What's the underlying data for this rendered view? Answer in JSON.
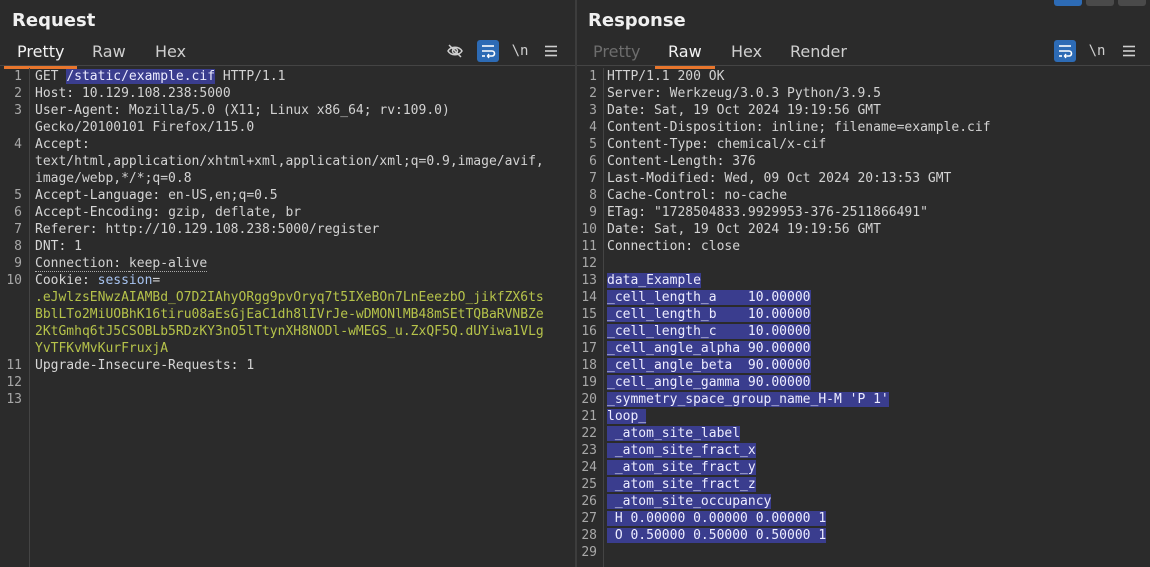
{
  "request": {
    "title": "Request",
    "tabs": [
      "Pretty",
      "Raw",
      "Hex"
    ],
    "lines": [
      {
        "n": "1",
        "parts": [
          [
            "GET ",
            "hv"
          ],
          [
            "/static/example.cif",
            "sel"
          ],
          [
            " HTTP/1.1",
            "hv"
          ]
        ]
      },
      {
        "n": "2",
        "parts": [
          [
            "Host: ",
            "hk"
          ],
          [
            "10.129.108.238:5000",
            "hv"
          ]
        ]
      },
      {
        "n": "3",
        "parts": [
          [
            "User-Agent: ",
            "hk"
          ],
          [
            "Mozilla/5.0 (X11; Linux x86_64; rv:109.0)",
            "hv"
          ]
        ]
      },
      {
        "n": "",
        "parts": [
          [
            "Gecko/20100101 Firefox/115.0",
            "hv"
          ]
        ]
      },
      {
        "n": "4",
        "parts": [
          [
            "Accept:",
            "hk"
          ]
        ]
      },
      {
        "n": "",
        "parts": [
          [
            "text/html,application/xhtml+xml,application/xml;q=0.9,image/avif,",
            "hv"
          ]
        ]
      },
      {
        "n": "",
        "parts": [
          [
            "image/webp,*/*;q=0.8",
            "hv"
          ]
        ]
      },
      {
        "n": "5",
        "parts": [
          [
            "Accept-Language: ",
            "hk"
          ],
          [
            "en-US,en;q=0.5",
            "hv"
          ]
        ]
      },
      {
        "n": "6",
        "parts": [
          [
            "Accept-Encoding: ",
            "hk"
          ],
          [
            "gzip, deflate, br",
            "hv"
          ]
        ]
      },
      {
        "n": "7",
        "parts": [
          [
            "Referer: ",
            "hk"
          ],
          [
            "http://10.129.108.238:5000/register",
            "hv"
          ]
        ]
      },
      {
        "n": "8",
        "parts": [
          [
            "DNT: ",
            "hk"
          ],
          [
            "1",
            "hv"
          ]
        ]
      },
      {
        "n": "9",
        "parts": [
          [
            "Connection: ",
            "dotted"
          ],
          [
            "keep-alive",
            "dotted"
          ]
        ]
      },
      {
        "n": "10",
        "parts": [
          [
            "Cookie: ",
            "hk"
          ],
          [
            "session",
            "ck"
          ],
          [
            "=",
            "hv"
          ]
        ]
      },
      {
        "n": "",
        "parts": [
          [
            ".eJwlzsENwzAIAMBd_O7D2IAhyORgg9pvOryq7t5IXeBOn7LnEeezbO_jikfZX6ts",
            "cv"
          ]
        ]
      },
      {
        "n": "",
        "parts": [
          [
            "BblLTo2MiUOBhK16tiru08aEsGjEaC1dh8lIVrJe-wDMONlMB48mSEtTQBaRVNBZe",
            "cv"
          ]
        ]
      },
      {
        "n": "",
        "parts": [
          [
            "2KtGmhq6tJ5CSOBLb5RDzKY3nO5lTtynXH8NODl-wMEGS_u.ZxQF5Q.dUYiwa1VLg",
            "cv"
          ]
        ]
      },
      {
        "n": "",
        "parts": [
          [
            "YvTFKvMvKurFruxjA",
            "cv"
          ]
        ]
      },
      {
        "n": "11",
        "parts": [
          [
            "Upgrade-Insecure-Requests: ",
            "hk"
          ],
          [
            "1",
            "hv"
          ]
        ]
      },
      {
        "n": "12",
        "parts": []
      },
      {
        "n": "13",
        "parts": []
      }
    ]
  },
  "response": {
    "title": "Response",
    "tabs": [
      "Pretty",
      "Raw",
      "Hex",
      "Render"
    ],
    "lines": [
      {
        "n": "1",
        "parts": [
          [
            "HTTP/1.1 200 OK",
            "hv"
          ]
        ]
      },
      {
        "n": "2",
        "parts": [
          [
            "Server: ",
            "hk"
          ],
          [
            "Werkzeug/3.0.3 Python/3.9.5",
            "hv"
          ]
        ]
      },
      {
        "n": "3",
        "parts": [
          [
            "Date: ",
            "hk"
          ],
          [
            "Sat, 19 Oct 2024 19:19:56 GMT",
            "hv"
          ]
        ]
      },
      {
        "n": "4",
        "parts": [
          [
            "Content-Disposition: ",
            "hk"
          ],
          [
            "inline; filename=example.cif",
            "hv"
          ]
        ]
      },
      {
        "n": "5",
        "parts": [
          [
            "Content-Type: ",
            "hk"
          ],
          [
            "chemical/x-cif",
            "hv"
          ]
        ]
      },
      {
        "n": "6",
        "parts": [
          [
            "Content-Length: ",
            "hk"
          ],
          [
            "376",
            "hv"
          ]
        ]
      },
      {
        "n": "7",
        "parts": [
          [
            "Last-Modified: ",
            "hk"
          ],
          [
            "Wed, 09 Oct 2024 20:13:53 GMT",
            "hv"
          ]
        ]
      },
      {
        "n": "8",
        "parts": [
          [
            "Cache-Control: ",
            "hk"
          ],
          [
            "no-cache",
            "hv"
          ]
        ]
      },
      {
        "n": "9",
        "parts": [
          [
            "ETag: ",
            "hk"
          ],
          [
            "\"1728504833.9929953-376-2511866491\"",
            "hv"
          ]
        ]
      },
      {
        "n": "10",
        "parts": [
          [
            "Date: ",
            "hk"
          ],
          [
            "Sat, 19 Oct 2024 19:19:56 GMT",
            "hv"
          ]
        ]
      },
      {
        "n": "11",
        "parts": [
          [
            "Connection: ",
            "hk"
          ],
          [
            "close",
            "hv"
          ]
        ]
      },
      {
        "n": "12",
        "parts": []
      },
      {
        "n": "13",
        "parts": [
          [
            "data_Example",
            "sel"
          ]
        ]
      },
      {
        "n": "14",
        "parts": [
          [
            "_cell_length_a    10.00000",
            "sel"
          ]
        ]
      },
      {
        "n": "15",
        "parts": [
          [
            "_cell_length_b    10.00000",
            "sel"
          ]
        ]
      },
      {
        "n": "16",
        "parts": [
          [
            "_cell_length_c    10.00000",
            "sel"
          ]
        ]
      },
      {
        "n": "17",
        "parts": [
          [
            "_cell_angle_alpha 90.00000",
            "sel"
          ]
        ]
      },
      {
        "n": "18",
        "parts": [
          [
            "_cell_angle_beta  90.00000",
            "sel"
          ]
        ]
      },
      {
        "n": "19",
        "parts": [
          [
            "_cell_angle_gamma 90.00000",
            "sel"
          ]
        ]
      },
      {
        "n": "20",
        "parts": [
          [
            "_symmetry_space_group_name_H-M 'P 1'",
            "sel"
          ]
        ]
      },
      {
        "n": "21",
        "parts": [
          [
            "loop_",
            "sel"
          ]
        ]
      },
      {
        "n": "22",
        "parts": [
          [
            " _atom_site_label",
            "sel"
          ]
        ]
      },
      {
        "n": "23",
        "parts": [
          [
            " _atom_site_fract_x",
            "sel"
          ]
        ]
      },
      {
        "n": "24",
        "parts": [
          [
            " _atom_site_fract_y",
            "sel"
          ]
        ]
      },
      {
        "n": "25",
        "parts": [
          [
            " _atom_site_fract_z",
            "sel"
          ]
        ]
      },
      {
        "n": "26",
        "parts": [
          [
            " _atom_site_occupancy",
            "sel"
          ]
        ]
      },
      {
        "n": "27",
        "parts": [
          [
            " H 0.00000 0.00000 0.00000 1",
            "sel"
          ]
        ]
      },
      {
        "n": "28",
        "parts": [
          [
            " O 0.50000 0.50000 0.50000 1",
            "sel"
          ]
        ]
      },
      {
        "n": "29",
        "parts": []
      }
    ]
  },
  "icons": {
    "hide": "eye-slash-icon",
    "wrap": "word-wrap-icon",
    "newline": "\\n",
    "menu": "hamburger-menu-icon"
  },
  "colors": {
    "accent": "#e8762d",
    "selection": "#3a3d8e",
    "cookie_value": "#b6c34a",
    "toggle_on": "#2d6bb5"
  }
}
